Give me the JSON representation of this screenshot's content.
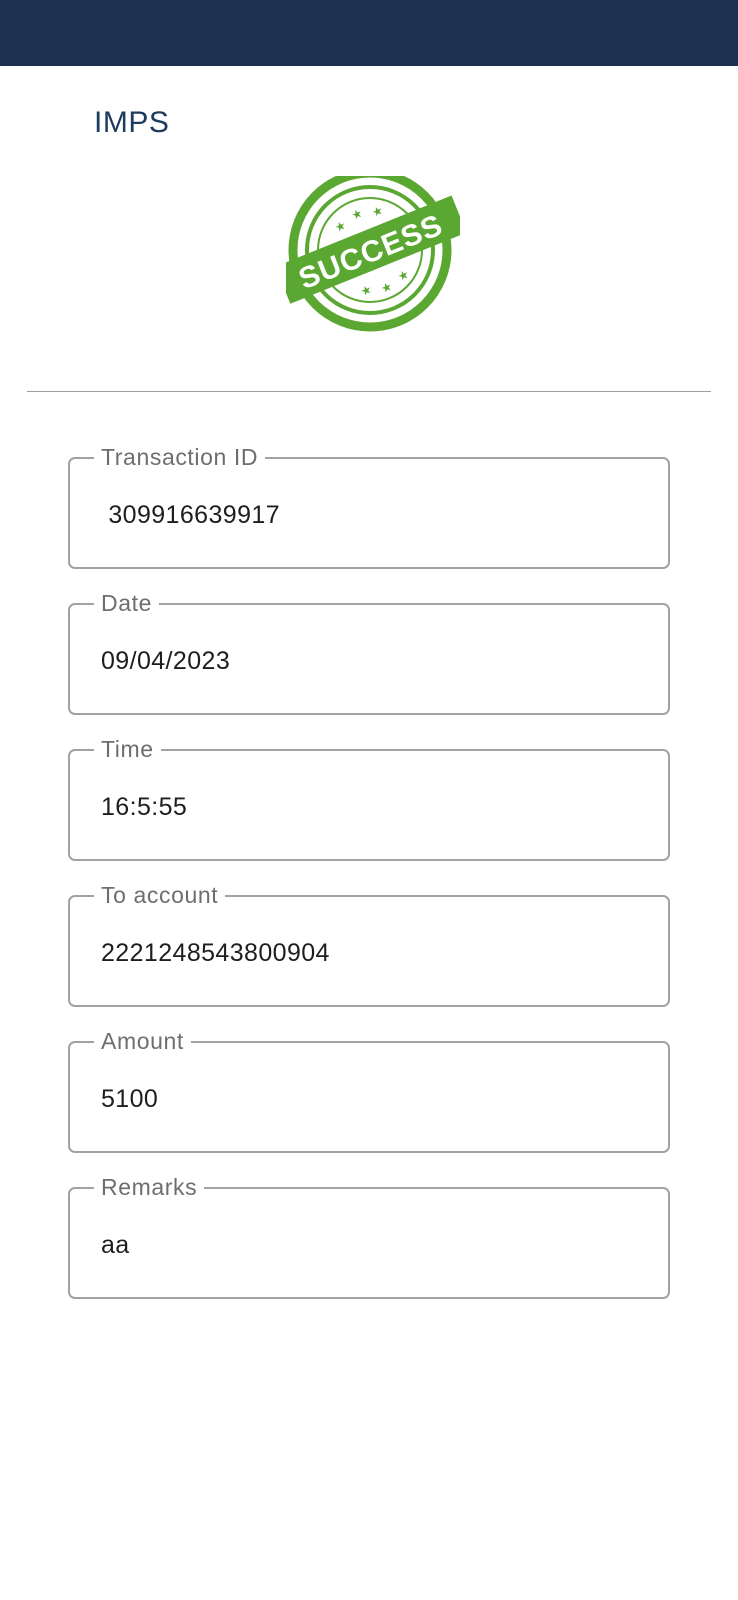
{
  "header": {
    "title": "IMPS"
  },
  "stamp": {
    "text": "SUCCESS",
    "icon": "success-stamp-icon",
    "color": "#5aa832"
  },
  "colors": {
    "topbar": "#1c3152",
    "title": "#1f3a5f"
  },
  "fields": [
    {
      "label": "Transaction ID",
      "value": " 309916639917"
    },
    {
      "label": "Date",
      "value": "09/04/2023"
    },
    {
      "label": "Time",
      "value": "16:5:55"
    },
    {
      "label": "To account",
      "value": "2221248543800904"
    },
    {
      "label": "Amount",
      "value": "5100"
    },
    {
      "label": "Remarks",
      "value": "aa"
    }
  ]
}
